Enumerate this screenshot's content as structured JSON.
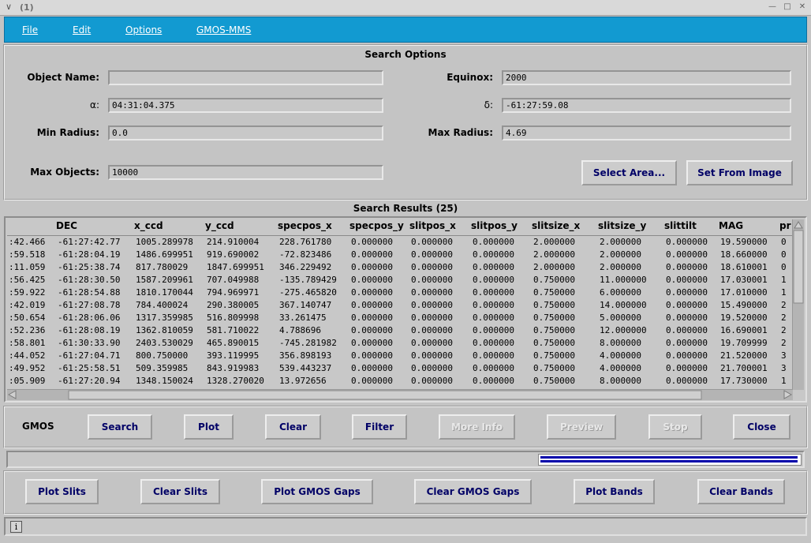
{
  "window": {
    "title": "(1)"
  },
  "menu": [
    "File",
    "Edit",
    "Options",
    "GMOS-MMS"
  ],
  "search_options": {
    "title": "Search Options",
    "object_name": {
      "label": "Object Name:",
      "value": ""
    },
    "equinox": {
      "label": "Equinox:",
      "value": "2000"
    },
    "alpha": {
      "label": "α:",
      "value": "04:31:04.375"
    },
    "delta": {
      "label": "δ:",
      "value": "-61:27:59.08"
    },
    "min_radius": {
      "label": "Min Radius:",
      "value": "0.0"
    },
    "max_radius": {
      "label": "Max Radius:",
      "value": "4.69"
    },
    "max_objects": {
      "label": "Max Objects:",
      "value": "10000"
    },
    "select_area": "Select Area...",
    "set_from_image": "Set From Image"
  },
  "results": {
    "title": "Search Results (25)",
    "columns": [
      "DEC",
      "x_ccd",
      "y_ccd",
      "specpos_x",
      "specpos_y",
      "slitpos_x",
      "slitpos_y",
      "slitsize_x",
      "slitsize_y",
      "slittilt",
      "MAG",
      "pr"
    ],
    "rows": [
      [
        ":42.466",
        "-61:27:42.77",
        "1005.289978",
        "214.910004",
        "228.761780",
        "0.000000",
        "0.000000",
        "0.000000",
        "2.000000",
        "2.000000",
        "0.000000",
        "19.590000",
        "0"
      ],
      [
        ":59.518",
        "-61:28:04.19",
        "1486.699951",
        "919.690002",
        "-72.823486",
        "0.000000",
        "0.000000",
        "0.000000",
        "2.000000",
        "2.000000",
        "0.000000",
        "18.660000",
        "0"
      ],
      [
        ":11.059",
        "-61:25:38.74",
        "817.780029",
        "1847.699951",
        "346.229492",
        "0.000000",
        "0.000000",
        "0.000000",
        "2.000000",
        "2.000000",
        "0.000000",
        "18.610001",
        "0"
      ],
      [
        ":56.425",
        "-61:28:30.50",
        "1587.209961",
        "707.049988",
        "-135.789429",
        "0.000000",
        "0.000000",
        "0.000000",
        "0.750000",
        "11.000000",
        "0.000000",
        "17.030001",
        "1"
      ],
      [
        ":59.922",
        "-61:28:54.88",
        "1810.170044",
        "794.969971",
        "-275.465820",
        "0.000000",
        "0.000000",
        "0.000000",
        "0.750000",
        "6.000000",
        "0.000000",
        "17.010000",
        "1"
      ],
      [
        ":42.019",
        "-61:27:08.78",
        "784.400024",
        "290.380005",
        "367.140747",
        "0.000000",
        "0.000000",
        "0.000000",
        "0.750000",
        "14.000000",
        "0.000000",
        "15.490000",
        "2"
      ],
      [
        ":50.654",
        "-61:28:06.06",
        "1317.359985",
        "516.809998",
        "33.261475",
        "0.000000",
        "0.000000",
        "0.000000",
        "0.750000",
        "5.000000",
        "0.000000",
        "19.520000",
        "2"
      ],
      [
        ":52.236",
        "-61:28:08.19",
        "1362.810059",
        "581.710022",
        "4.788696",
        "0.000000",
        "0.000000",
        "0.000000",
        "0.750000",
        "12.000000",
        "0.000000",
        "16.690001",
        "2"
      ],
      [
        ":58.801",
        "-61:30:33.90",
        "2403.530029",
        "465.890015",
        "-745.281982",
        "0.000000",
        "0.000000",
        "0.000000",
        "0.750000",
        "8.000000",
        "0.000000",
        "19.709999",
        "2"
      ],
      [
        ":44.052",
        "-61:27:04.71",
        "800.750000",
        "393.119995",
        "356.898193",
        "0.000000",
        "0.000000",
        "0.000000",
        "0.750000",
        "4.000000",
        "0.000000",
        "21.520000",
        "3"
      ],
      [
        ":49.952",
        "-61:25:58.51",
        "509.359985",
        "843.919983",
        "539.443237",
        "0.000000",
        "0.000000",
        "0.000000",
        "0.750000",
        "4.000000",
        "0.000000",
        "21.700001",
        "3"
      ],
      [
        ":05.909",
        "-61:27:20.94",
        "1348.150024",
        "1328.270020",
        "13.972656",
        "0.000000",
        "0.000000",
        "0.000000",
        "0.750000",
        "8.000000",
        "0.000000",
        "17.730000",
        "1"
      ]
    ]
  },
  "gmos_label": "GMOS",
  "actions": {
    "search": "Search",
    "plot": "Plot",
    "clear": "Clear",
    "filter": "Filter",
    "more_info": "More Info",
    "preview": "Preview",
    "stop": "Stop",
    "close": "Close"
  },
  "plot_actions": {
    "plot_slits": "Plot Slits",
    "clear_slits": "Clear Slits",
    "plot_gmos_gaps": "Plot GMOS Gaps",
    "clear_gmos_gaps": "Clear GMOS Gaps",
    "plot_bands": "Plot Bands",
    "clear_bands": "Clear Bands"
  },
  "status": {
    "text": "",
    "info_icon": "i"
  },
  "colors": {
    "menubar": "#129ad1",
    "button_text": "#000066",
    "busy_bar": "#0000aa"
  }
}
